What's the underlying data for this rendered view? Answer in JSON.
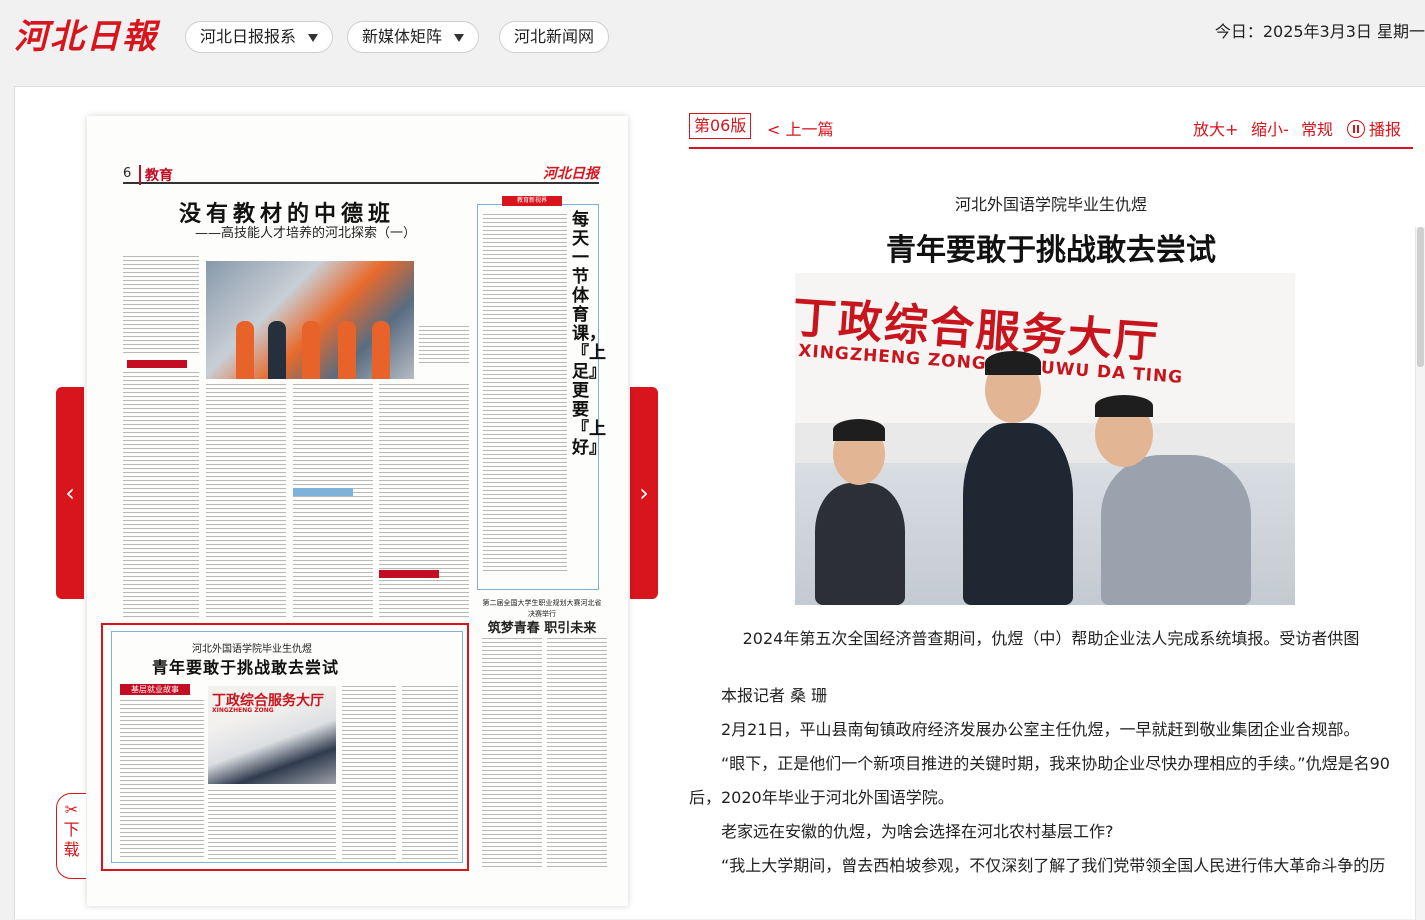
{
  "header": {
    "logo_text": "河北日報",
    "nav": [
      {
        "label": "河北日报报系",
        "dropdown": true
      },
      {
        "label": "新媒体矩阵",
        "dropdown": true
      },
      {
        "label": "河北新闻网",
        "dropdown": false
      }
    ],
    "date_text": "今日：2025年3月3日  星期一"
  },
  "newspaper": {
    "page_number": "6",
    "section": "教育",
    "header_logo": "河北日报",
    "headline": "没有教材的中德班",
    "subheadline": "——高技能人才培养的河北探索（一）",
    "side_red_label": "教育新视界",
    "vertical_title": "每天一节体育课，『上足』更要『上好』",
    "right_headline_kicker": "第二届全国大学生职业规划大赛河北省决赛举行",
    "right_headline": "筑梦青春 职引未来",
    "selected_article": {
      "kicker": "河北外国语学院毕业生仇煜",
      "title": "青年要敢于挑战敢去尝试",
      "tag": "基层就业故事",
      "photo_sign": "丁政综合服务大厅",
      "photo_sign_pinyin": "XINGZHENG ZONG"
    }
  },
  "controls": {
    "prev_page_arrow": "‹",
    "next_page_arrow": "›",
    "download_label": "下载"
  },
  "article": {
    "edition_badge": "第06版",
    "prev_link": "< 上一篇",
    "tools": [
      "放大+",
      "缩小-",
      "常规",
      "播报"
    ],
    "kicker": "河北外国语学院毕业生仇煜",
    "title": "青年要敢于挑战敢去尝试",
    "photo_sign": "丁政综合服务大厅",
    "photo_sign_pinyin": "XINGZHENG ZONG HE FUWU DA TING",
    "caption": "2024年第五次全国经济普查期间，仇煜（中）帮助企业法人完成系统填报。受访者供图",
    "paragraphs": [
      "本报记者 桑 珊",
      "2月21日，平山县南甸镇政府经济发展办公室主任仇煜，一早就赶到敬业集团企业合规部。",
      "“眼下，正是他们一个新项目推进的关键时期，我来协助企业尽快办理相应的手续。”仇煜是名90后，2020年毕业于河北外国语学院。",
      "老家远在安徽的仇煜，为啥会选择在河北农村基层工作?",
      "“我上大学期间，曾去西柏坡参观，不仅深刻了解了我们党带领全国人民进行伟大革命斗争的历"
    ]
  },
  "colors": {
    "brand_red": "#d8141c",
    "border_blue": "#7fb2d9"
  }
}
